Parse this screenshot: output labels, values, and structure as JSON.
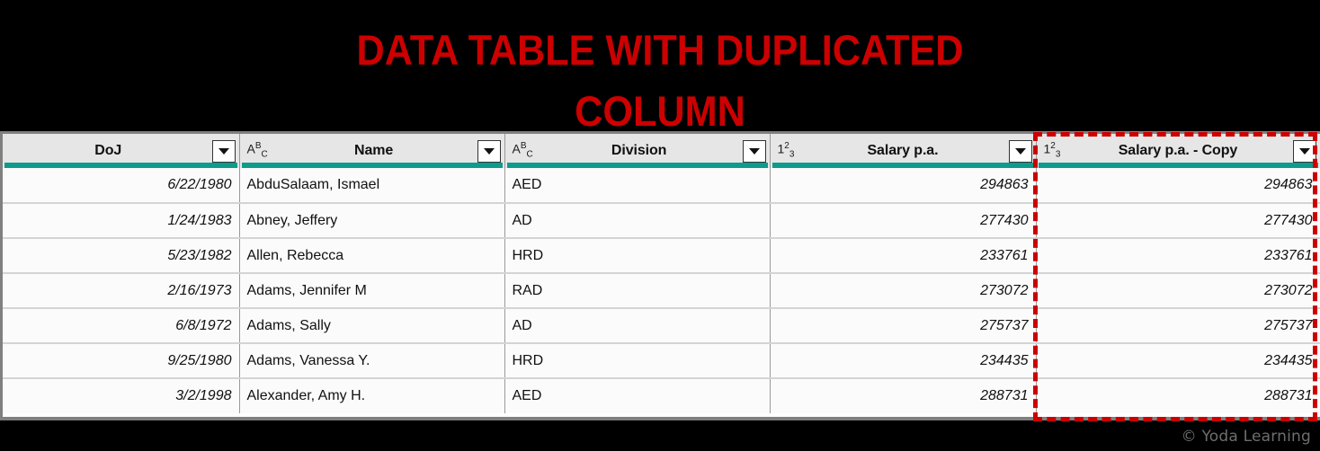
{
  "title": {
    "text": "DATA TABLE WITH DUPLICATED\nCOLUMN",
    "color": "#CC0000",
    "background": "#000000"
  },
  "watermark": {
    "text": "© Yoda Learning"
  },
  "highlight": {
    "color": "#CC0000",
    "style": "dashed",
    "target_column": "Salary p.a. - Copy"
  },
  "table": {
    "accent_color": "#0E9B8C",
    "header_background": "#E6E6E6",
    "row_background": "#FBFBFB",
    "columns": [
      {
        "label": "DoJ",
        "type_icon": "",
        "align": "num"
      },
      {
        "label": "Name",
        "type_icon": "ABC",
        "align": "txt"
      },
      {
        "label": "Division",
        "type_icon": "ABC",
        "align": "txt"
      },
      {
        "label": "Salary p.a.",
        "type_icon": "123",
        "align": "num"
      },
      {
        "label": "Salary p.a. - Copy",
        "type_icon": "123",
        "align": "num"
      }
    ],
    "rows": [
      {
        "doj": "6/22/1980",
        "name": "AbduSalaam, Ismael",
        "division": "AED",
        "salary": "294863",
        "salary_copy": "294863"
      },
      {
        "doj": "1/24/1983",
        "name": "Abney, Jeffery",
        "division": "AD",
        "salary": "277430",
        "salary_copy": "277430"
      },
      {
        "doj": "5/23/1982",
        "name": "Allen, Rebecca",
        "division": "HRD",
        "salary": "233761",
        "salary_copy": "233761"
      },
      {
        "doj": "2/16/1973",
        "name": "Adams, Jennifer M",
        "division": "RAD",
        "salary": "273072",
        "salary_copy": "273072"
      },
      {
        "doj": "6/8/1972",
        "name": "Adams, Sally",
        "division": "AD",
        "salary": "275737",
        "salary_copy": "275737"
      },
      {
        "doj": "9/25/1980",
        "name": "Adams, Vanessa Y.",
        "division": "HRD",
        "salary": "234435",
        "salary_copy": "234435"
      },
      {
        "doj": "3/2/1998",
        "name": "Alexander, Amy H.",
        "division": "AED",
        "salary": "288731",
        "salary_copy": "288731"
      }
    ]
  }
}
